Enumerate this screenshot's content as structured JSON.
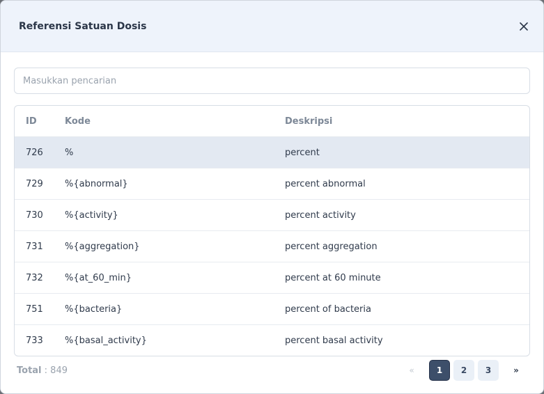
{
  "modal": {
    "title": "Referensi Satuan Dosis"
  },
  "search": {
    "placeholder": "Masukkan pencarian",
    "value": ""
  },
  "table": {
    "headers": [
      "ID",
      "Kode",
      "Deskripsi"
    ],
    "rows": [
      {
        "id": "726",
        "kode": "%",
        "deskripsi": "percent"
      },
      {
        "id": "729",
        "kode": "%{abnormal}",
        "deskripsi": "percent abnormal"
      },
      {
        "id": "730",
        "kode": "%{activity}",
        "deskripsi": "percent activity"
      },
      {
        "id": "731",
        "kode": "%{aggregation}",
        "deskripsi": "percent aggregation"
      },
      {
        "id": "732",
        "kode": "%{at_60_min}",
        "deskripsi": "percent at 60 minute"
      },
      {
        "id": "751",
        "kode": "%{bacteria}",
        "deskripsi": "percent of bacteria"
      },
      {
        "id": "733",
        "kode": "%{basal_activity}",
        "deskripsi": "percent basal activity"
      }
    ],
    "selected_index": 0
  },
  "footer": {
    "total_label": "Total",
    "total_separator": " : ",
    "total_value": "849"
  },
  "pagination": {
    "prev": "«",
    "pages": [
      "1",
      "2",
      "3"
    ],
    "active": "1",
    "next": "»"
  },
  "icons": {
    "close": "close-icon"
  }
}
